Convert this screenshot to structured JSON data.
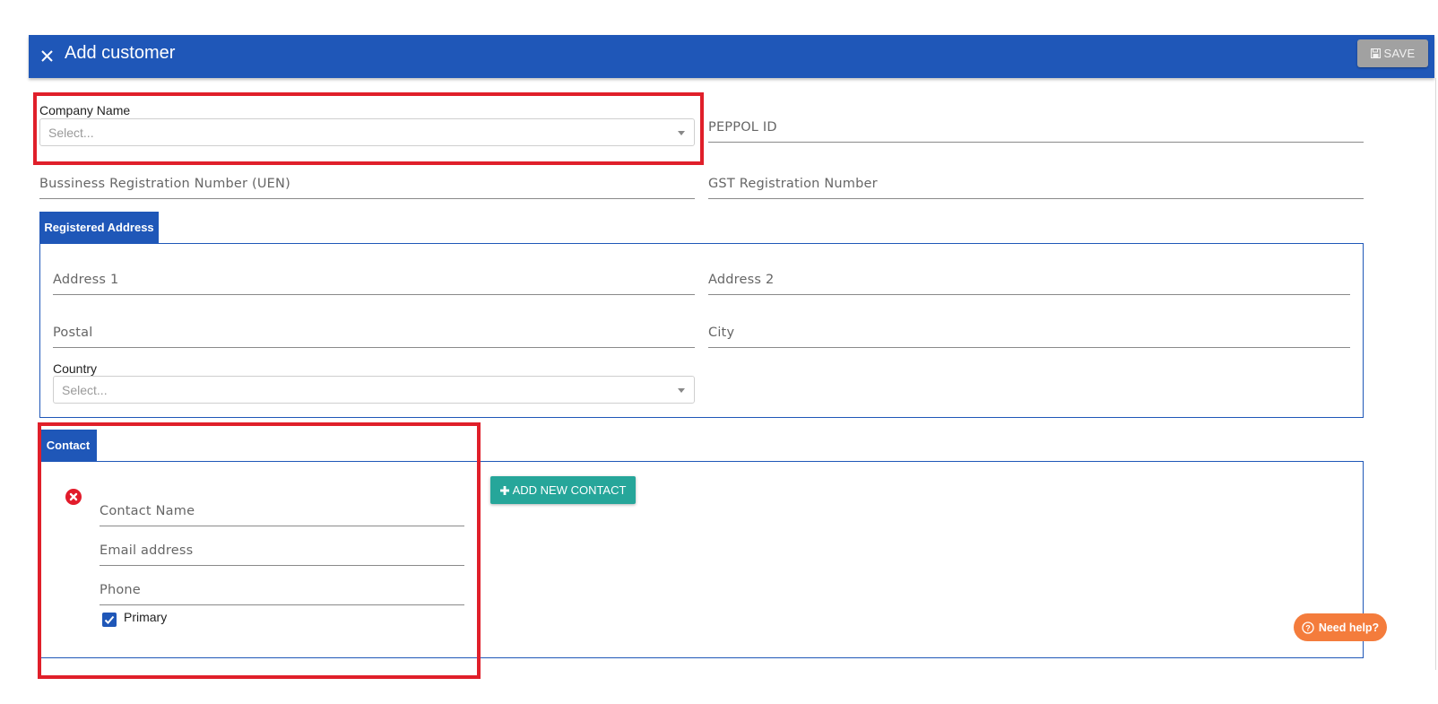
{
  "header": {
    "title": "Add customer",
    "save_label": "SAVE"
  },
  "company": {
    "label": "Company Name",
    "placeholder": "Select..."
  },
  "fields": {
    "peppol_id": "PEPPOL ID",
    "uen": "Bussiness Registration Number (UEN)",
    "gst": "GST Registration Number"
  },
  "registered_address": {
    "tab_label": "Registered Address",
    "address1": "Address 1",
    "address2": "Address 2",
    "postal": "Postal",
    "city": "City",
    "country_label": "Country",
    "country_placeholder": "Select..."
  },
  "contact": {
    "tab_label": "Contact",
    "add_button": "ADD NEW CONTACT",
    "name": "Contact Name",
    "email": "Email address",
    "phone": "Phone",
    "primary_label": "Primary",
    "primary_checked": true
  },
  "help": {
    "label": "Need help?"
  },
  "colors": {
    "header": "#1f57b8",
    "save_button": "#a1a1a1",
    "add_contact_button": "#26a69a",
    "help_button": "#f47c3c",
    "annotation_highlight": "#e01f2a"
  }
}
